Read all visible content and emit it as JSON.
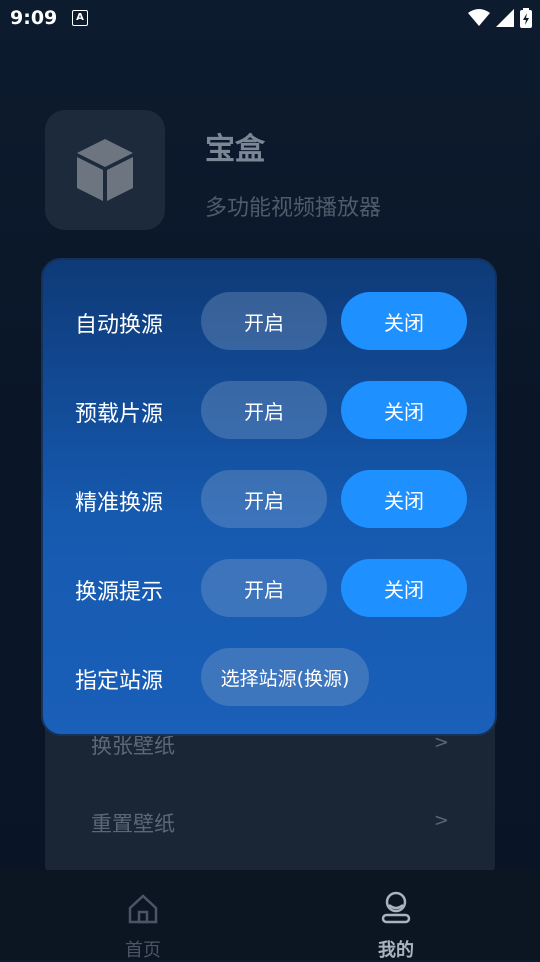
{
  "status_bar": {
    "time": "9:09",
    "a_badge": "A"
  },
  "background": {
    "app_name": "宝盒",
    "app_subtitle": "多功能视频播放器",
    "settings": [
      {
        "label": "换张壁纸",
        "arrow": ">"
      },
      {
        "label": "重置壁纸",
        "arrow": ">"
      }
    ]
  },
  "dialog": {
    "rows": [
      {
        "label": "自动换源",
        "on": "开启",
        "off": "关闭"
      },
      {
        "label": "预载片源",
        "on": "开启",
        "off": "关闭"
      },
      {
        "label": "精准换源",
        "on": "开启",
        "off": "关闭"
      },
      {
        "label": "换源提示",
        "on": "开启",
        "off": "关闭"
      }
    ],
    "site_row": {
      "label": "指定站源",
      "button": "选择站源(换源)"
    }
  },
  "bottom_nav": {
    "items": [
      {
        "label": "首页",
        "icon": "home-icon"
      },
      {
        "label": "我的",
        "icon": "user-icon"
      }
    ]
  },
  "colors": {
    "accent": "#1e90ff",
    "dialog_top": "#0e3a78",
    "dialog_bottom": "#1a5fb8"
  }
}
